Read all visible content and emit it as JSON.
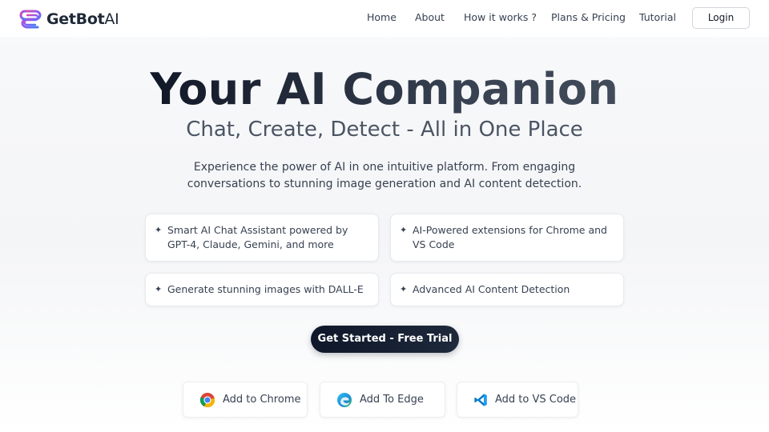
{
  "brand": {
    "name_bold": "GetBot",
    "name_light": "AI"
  },
  "nav": {
    "links": [
      "Home",
      "About",
      "How it works ?",
      "Plans & Pricing",
      "Tutorial"
    ],
    "login": "Login"
  },
  "hero": {
    "title": "Your AI Companion",
    "subtitle": "Chat, Create, Detect - All in One Place",
    "description": "Experience the power of AI in one intuitive platform. From engaging conversations to stunning image generation and AI content detection."
  },
  "features": [
    "Smart AI Chat Assistant powered by GPT-4, Claude, Gemini, and more",
    "AI-Powered extensions for Chrome and VS Code",
    "Generate stunning images with DALL-E",
    "Advanced AI Content Detection"
  ],
  "feature_icon": "sparkle-icon",
  "cta": {
    "label": "Get Started - Free Trial"
  },
  "extensions": [
    {
      "label": "Add to Chrome",
      "icon": "chrome-icon"
    },
    {
      "label": "Add To Edge",
      "icon": "edge-icon"
    },
    {
      "label": "Add to VS Code",
      "icon": "vscode-icon"
    }
  ],
  "colors": {
    "cta_bg": "#0f172a",
    "text_dark": "#1f2937",
    "logo_gradient": [
      "#ec4899",
      "#8b5cf6",
      "#3b82f6"
    ]
  }
}
